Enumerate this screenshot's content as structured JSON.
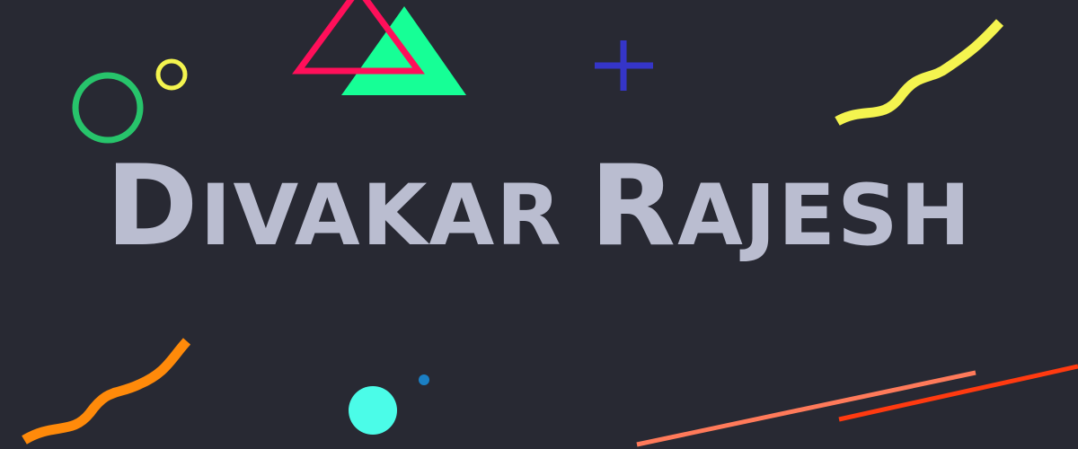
{
  "heading": {
    "first_word": [
      "D",
      "IVAKAR"
    ],
    "second_word": [
      "R",
      "AJESH"
    ]
  },
  "colors": {
    "background": "#282933",
    "text": "#babdd0",
    "green_ring": "#27c46b",
    "yellow": "#f4f44f",
    "pink": "#ff0f5a",
    "mint": "#16ff96",
    "blue_plus": "#3535c8",
    "orange": "#ff8a0a",
    "cyan": "#4bfce8",
    "dot_blue": "#1a7fc4",
    "salmon": "#ff7a5a",
    "red": "#ff3a10"
  },
  "decorations": [
    "ring-icon",
    "small-ring-icon",
    "triangle-icon",
    "outline-triangle-icon",
    "plus-icon",
    "squiggle-icon",
    "circle-icon",
    "dot-icon",
    "line-icon"
  ]
}
